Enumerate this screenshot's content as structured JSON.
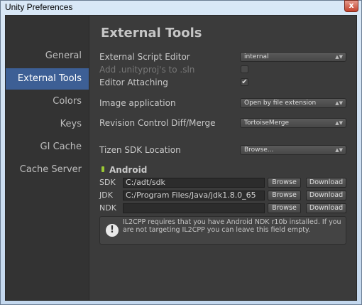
{
  "window": {
    "title": "Unity Preferences",
    "close_glyph": "x"
  },
  "sidebar": {
    "items": [
      {
        "label": "General"
      },
      {
        "label": "External Tools",
        "active": true
      },
      {
        "label": "Colors"
      },
      {
        "label": "Keys"
      },
      {
        "label": "GI Cache"
      },
      {
        "label": "Cache Server"
      }
    ]
  },
  "main": {
    "heading": "External Tools",
    "script_editor": {
      "label": "External Script Editor",
      "value": "internal"
    },
    "add_unityproj": {
      "label": "Add .unityproj's to .sln",
      "checked": false,
      "enabled": false
    },
    "editor_attaching": {
      "label": "Editor Attaching",
      "checked": true
    },
    "image_app": {
      "label": "Image application",
      "value": "Open by file extension"
    },
    "revision_control": {
      "label": "Revision Control Diff/Merge",
      "value": "TortoiseMerge"
    },
    "tizen_sdk": {
      "label": "Tizen SDK Location",
      "value": "Browse..."
    },
    "android": {
      "title": "Android",
      "sdk": {
        "label": "SDK",
        "path": "C:/adt/sdk"
      },
      "jdk": {
        "label": "JDK",
        "path": "C:/Program Files/Java/jdk1.8.0_65"
      },
      "ndk": {
        "label": "NDK",
        "path": ""
      },
      "browse_label": "Browse",
      "download_label": "Download",
      "help_text": "IL2CPP requires that you have Android NDK r10b installed. If you are not targeting IL2CPP you can leave this field empty."
    }
  },
  "colors": {
    "active_item": "#3d5f95",
    "panel_bg": "#3b3b3b",
    "sidebar_bg": "#333333"
  }
}
